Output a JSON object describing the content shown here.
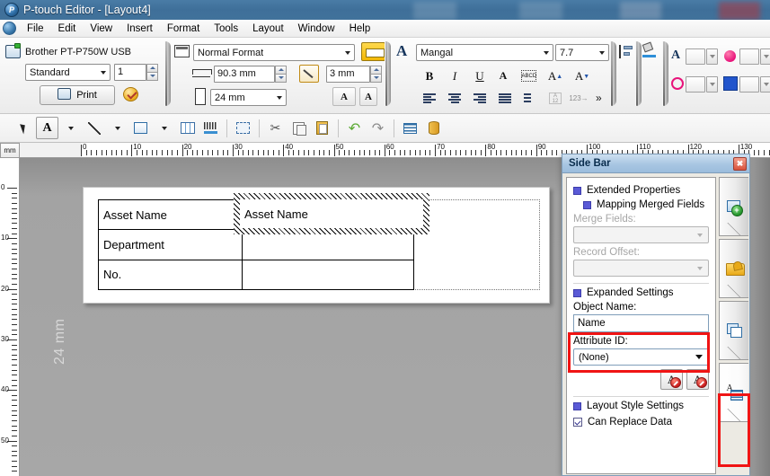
{
  "window": {
    "title": "P-touch Editor - [Layout4]",
    "app_icon": "ptouch-logo-icon"
  },
  "menubar": {
    "doc_icon": "document-control-icon",
    "items": [
      "File",
      "Edit",
      "View",
      "Insert",
      "Format",
      "Tools",
      "Layout",
      "Window",
      "Help"
    ]
  },
  "print_panel": {
    "printer_icon": "printer-icon",
    "printer_name": "Brother PT-P750W USB",
    "mode_value": "Standard",
    "copies_value": "1",
    "print_label": "Print",
    "print_icon": "printer-small-icon",
    "print_options_icon": "print-options-icon"
  },
  "format_panel": {
    "layout_icon": "label-layout-icon",
    "format_value": "Normal Format",
    "label_preview_icon": "yellow-label-icon",
    "width_icon": "label-length-icon",
    "length_value": "90.3 mm",
    "auto_icon": "auto-format-wand-icon",
    "margin_value": "3 mm",
    "height_icon": "tape-width-icon",
    "tape_value": "24 mm",
    "text_fit_icon": "text-fit-icon",
    "text_frame_icon": "text-frame-icon"
  },
  "font_panel": {
    "font_icon": "font-A-icon",
    "font_family": "Mangal",
    "font_size": "7.7",
    "bold_label": "B",
    "italic_label": "I",
    "underline_label": "U",
    "text_effect_icon": "text-effect-icon",
    "text_lock_icon": "text-lock-abcd-icon",
    "grow_icon": "increase-font-icon",
    "shrink_icon": "decrease-font-icon",
    "align_left_icon": "align-left-icon",
    "align_center_icon": "align-center-icon",
    "align_right_icon": "align-right-icon",
    "align_justify_icon": "align-justify-icon",
    "line_spacing_icon": "line-spacing-icon",
    "char_spacing_icon": "character-spacing-icon",
    "text_direction_icon": "text-direction-icon",
    "overflow_label": "»"
  },
  "color_panel": {
    "layout_group_icon": "object-align-icon",
    "fill_group_icon": "fill-color-icon",
    "text_color_icon": "text-color-A-icon",
    "fill_color_icon": "fill-circle-icon",
    "line_color_icon": "line-color-icon",
    "bg_color_icon": "background-color-icon",
    "dropdown_icon": "chevron-down-icon"
  },
  "drawbar": {
    "buttons": [
      {
        "name": "select-arrow-tool",
        "icon": "cursor-arrow-icon",
        "selected": false
      },
      {
        "name": "text-tool",
        "icon": "text-A-icon",
        "selected": true
      },
      {
        "name": "text-tool-dropdown",
        "icon": "chevron-down-icon",
        "selected": false
      },
      {
        "name": "line-tool",
        "icon": "line-icon",
        "selected": false
      },
      {
        "name": "line-tool-dropdown",
        "icon": "chevron-down-icon",
        "selected": false
      },
      {
        "name": "rectangle-tool",
        "icon": "rectangle-icon",
        "selected": false
      },
      {
        "name": "rectangle-tool-dropdown",
        "icon": "chevron-down-icon",
        "selected": false
      },
      {
        "name": "table-tool",
        "icon": "table-icon",
        "selected": false
      },
      {
        "name": "barcode-tool",
        "icon": "barcode-icon",
        "selected": false
      },
      {
        "name": "symbol-tool",
        "icon": "symbol-frame-icon",
        "selected": false
      },
      {
        "name": "cut-button",
        "icon": "scissors-icon",
        "selected": false
      },
      {
        "name": "copy-button",
        "icon": "copy-icon",
        "selected": false
      },
      {
        "name": "paste-button",
        "icon": "clipboard-icon",
        "selected": false
      },
      {
        "name": "undo-button",
        "icon": "undo-arrow-icon",
        "selected": false
      },
      {
        "name": "redo-button",
        "icon": "redo-arrow-icon",
        "selected": false
      },
      {
        "name": "database-view-button",
        "icon": "database-grid-icon",
        "selected": false
      },
      {
        "name": "database-button",
        "icon": "database-cylinder-icon",
        "selected": false
      }
    ]
  },
  "rulers": {
    "unit_label": "mm",
    "horizontal_labels": [
      "0",
      "10",
      "20",
      "30",
      "40",
      "50",
      "60",
      "70",
      "80",
      "90",
      "100",
      "110",
      "120",
      "130"
    ],
    "vertical_labels": [
      "0",
      "10",
      "20",
      "30",
      "40",
      "50"
    ]
  },
  "canvas": {
    "tape_width_label": "24 mm",
    "label_table": {
      "rows": [
        {
          "field": "Asset Name",
          "value": ""
        },
        {
          "field": "Department",
          "value": ""
        },
        {
          "field": "No.",
          "value": ""
        }
      ]
    },
    "selected_object_text": "Asset Name"
  },
  "sidebar": {
    "title": "Side Bar",
    "close_icon": "close-icon",
    "sections": {
      "extended_properties": "Extended Properties",
      "mapping_merged_fields": "Mapping Merged Fields",
      "expanded_settings": "Expanded Settings",
      "layout_style_settings": "Layout Style Settings"
    },
    "fields": {
      "merge_fields_label": "Merge Fields:",
      "merge_fields_value": "",
      "record_offset_label": "Record Offset:",
      "record_offset_value": "",
      "object_name_label": "Object Name:",
      "object_name_value": "Name",
      "attribute_id_label": "Attribute ID:",
      "attribute_id_value": "(None)",
      "can_replace_data_label": "Can Replace Data"
    },
    "attribute_buttons": [
      {
        "name": "set-attribute-button",
        "icon": "set-attribute-icon"
      },
      {
        "name": "clear-attribute-button",
        "icon": "clear-attribute-icon"
      }
    ],
    "tabs": [
      {
        "name": "sidebar-tab-new-object",
        "icon": "add-object-icon",
        "active": false
      },
      {
        "name": "sidebar-tab-favorites",
        "icon": "favorites-folder-icon",
        "active": false
      },
      {
        "name": "sidebar-tab-objects",
        "icon": "object-layers-icon",
        "active": false
      },
      {
        "name": "sidebar-tab-text-properties",
        "icon": "text-properties-icon",
        "active": true
      }
    ]
  },
  "annotations": {
    "highlight_color": "#f01414",
    "boxes": [
      "object-name-field-highlight",
      "text-properties-tab-highlight"
    ]
  }
}
